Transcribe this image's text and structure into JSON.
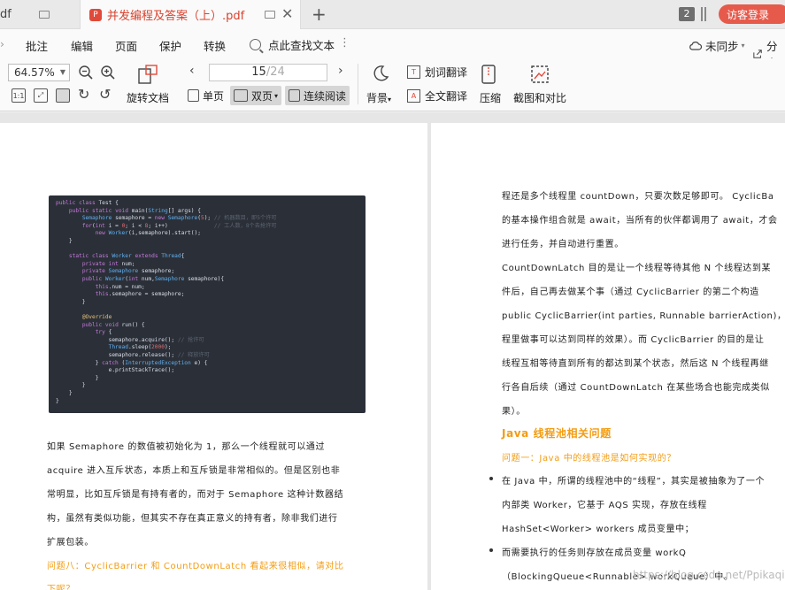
{
  "tabs": {
    "inactive_label": "df",
    "active_label": "并发编程及答案（上）.pdf",
    "pdf_badge": "P",
    "new_tab": "+",
    "count_badge": "2",
    "login": "访客登录"
  },
  "menu": {
    "items": [
      "批注",
      "编辑",
      "页面",
      "保护",
      "转换"
    ],
    "search": "点此查找文本",
    "more": "⋮",
    "sync": "未同步",
    "share": "分享"
  },
  "toolbar": {
    "zoom": "64.57%",
    "page_current": "15",
    "page_total": "/24",
    "rotate_label": "旋转文档",
    "single_page": "单页",
    "double_page": "双页",
    "continuous": "连续阅读",
    "background": "背景",
    "word_translate": "划词翻译",
    "full_translate": "全文翻译",
    "compress": "压缩",
    "screenshot": "截图和对比"
  },
  "left_page": {
    "code_lines": [
      "public class Test {",
      "    public static void main(String[] args) {",
      "        Semaphore semaphore = new Semaphore(5); // 机器数目，即5个许可",
      "        for(int i = 0; i < 8; i++)              // 工人数，8个去抢许可",
      "            new Worker(i,semaphore).start();",
      "    }",
      "",
      "    static class Worker extends Thread{",
      "        private int num;",
      "        private Semaphore semaphore;",
      "        public Worker(int num,Semaphore semaphore){",
      "            this.num = num;",
      "            this.semaphore = semaphore;",
      "        }",
      "",
      "        @Override",
      "        public void run() {",
      "            try {",
      "                semaphore.acquire(); // 抢许可",
      "                Thread.sleep(2000);",
      "                semaphore.release(); // 释放许可",
      "            } catch (InterruptedException e) {",
      "                e.printStackTrace();",
      "            }",
      "        }",
      "    }",
      "}"
    ],
    "paragraph": [
      "如果    Semaphore    的数值被初始化为     1，那么一个线程就可以通过",
      "acquire   进入互斥状态，本质上和互斥锁是非常相似的。但是区别也非",
      "常明显，比如互斥锁是有持有者的，而对于   Semaphore   这种计数器结",
      "构，虽然有类似功能，但其实不存在真正意义的持有者，除非我们进行",
      "扩展包装。"
    ],
    "question8": [
      "问题八：CyclicBarrier    和    CountDownLatch   看起来很相似，请对比",
      "下呢？"
    ]
  },
  "right_page": {
    "paragraph": [
      "程还是多个线程里    countDown，只要次数足够即可。    CyclicBa",
      "的基本操作组合就是    await，当所有的伙伴都调用了    await，才会",
      "进行任务，并自动进行重置。",
      "CountDownLatch   目的是让一个线程等待其他    N    个线程达到某",
      "件后，自己再去做某个事（通过      CyclicBarrier      的第二个构造",
      " public CyclicBarrier(int parties, Runnable barrierAction)，在",
      "程里做事可以达到同样的效果）。而   CyclicBarrier   的目的是让",
      "线程互相等待直到所有的都达到某个状态，然后这    N    个线程再继",
      "行各自后续（通过      CountDownLatch      在某些场合也能完成类似",
      "果）。"
    ],
    "heading": "Java  线程池相关问题",
    "question1": "问题一：Java  中的线程池是如何实现的？",
    "bullet1": [
      "在    Java    中，所谓的线程池中的“线程”，其实是被抽象为了一个",
      "内部类            Worker，它基于              AQS              实现，存放在线程",
      " HashSet<Worker> workers 成员变量中；"
    ],
    "bullet2": [
      "而需要执行的任务则存放在成员变量                                  workQ",
      "（BlockingQueue<Runnable> workQueue）中。"
    ],
    "watermark": "https://blog.csdn.net/Ppikaqiu"
  }
}
